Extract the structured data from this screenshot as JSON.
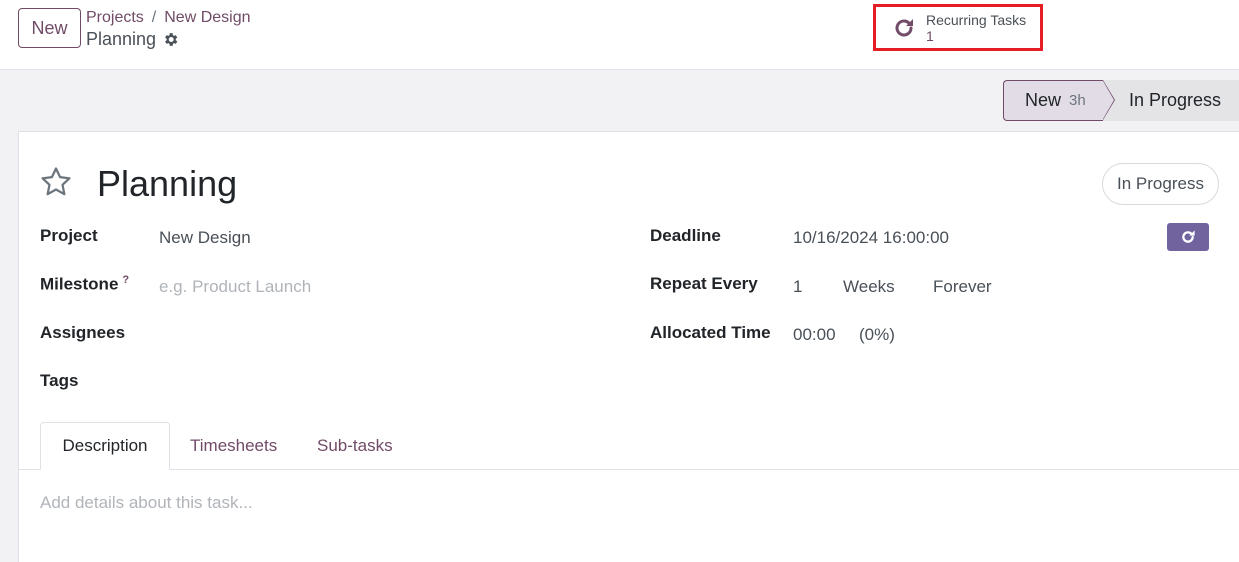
{
  "control_panel": {
    "new_button": "New",
    "breadcrumb": [
      {
        "label": "Projects"
      },
      {
        "label": "New Design"
      }
    ],
    "breadcrumb_separator": "/",
    "current_record": "Planning",
    "smart_button": {
      "label": "Recurring Tasks",
      "count": "1",
      "icon": "refresh-icon"
    }
  },
  "statusbar": {
    "stages": [
      {
        "label": "New",
        "badge": "3h",
        "active": true
      },
      {
        "label": "In Progress",
        "active": false
      }
    ]
  },
  "form": {
    "title": "Planning",
    "state": "In Progress",
    "fields_left": {
      "project": {
        "label": "Project",
        "value": "New Design"
      },
      "milestone": {
        "label": "Milestone",
        "tooltip_mark": "?",
        "placeholder": "e.g. Product Launch"
      },
      "assignees": {
        "label": "Assignees"
      },
      "tags": {
        "label": "Tags"
      }
    },
    "fields_right": {
      "deadline": {
        "label": "Deadline",
        "value": "10/16/2024 16:00:00"
      },
      "repeat_every": {
        "label": "Repeat Every",
        "interval": "1",
        "unit": "Weeks",
        "type": "Forever"
      },
      "allocated_time": {
        "label": "Allocated Time",
        "value": "00:00",
        "percent": "(0%)"
      }
    },
    "tabs": [
      {
        "label": "Description",
        "active": true
      },
      {
        "label": "Timesheets",
        "active": false
      },
      {
        "label": "Sub-tasks",
        "active": false
      }
    ],
    "description_placeholder": "Add details about this task..."
  },
  "colors": {
    "brand": "#714b67",
    "highlight_box": "#e51e25",
    "action_button": "#71639e"
  }
}
